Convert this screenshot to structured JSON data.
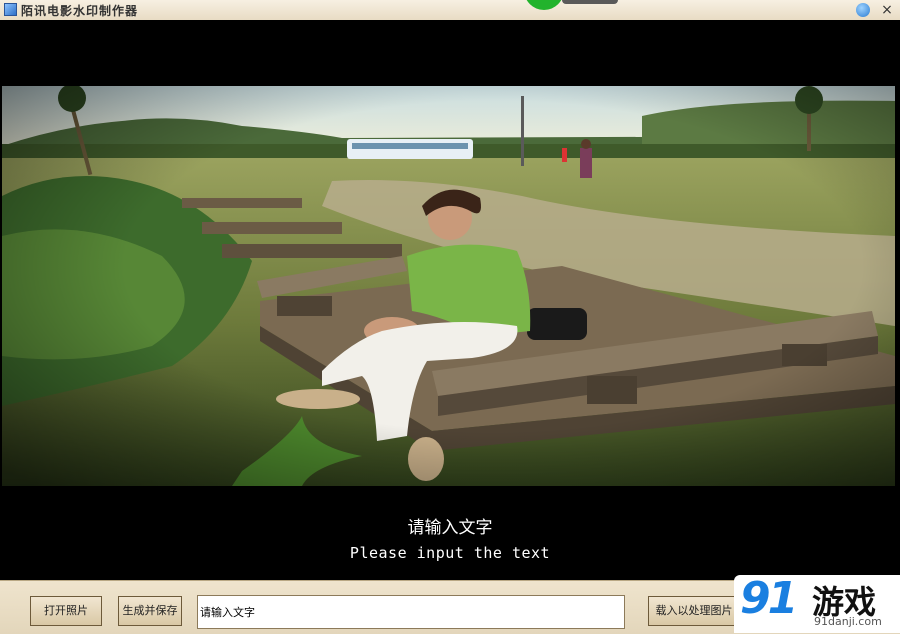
{
  "window": {
    "title": "陌讯电影水印制作器",
    "close_symbol": "×",
    "icons": [
      "app-icon",
      "skin-icon",
      "close-icon"
    ]
  },
  "canvas": {
    "caption_cn": "请输入文字",
    "caption_en": "Please input the text",
    "caption_color": "#ffffff",
    "background_color": "#000000"
  },
  "toolbar": {
    "open_photo_label": "打开照片",
    "generate_save_label": "生成并保存",
    "text_input_value": "请输入文字",
    "load_image_label": "载入以处理图片"
  },
  "watermark": {
    "brand_number": "91",
    "brand_cn": "游戏",
    "brand_url": "91danji.com",
    "brand_color": "#1a7fe0"
  }
}
